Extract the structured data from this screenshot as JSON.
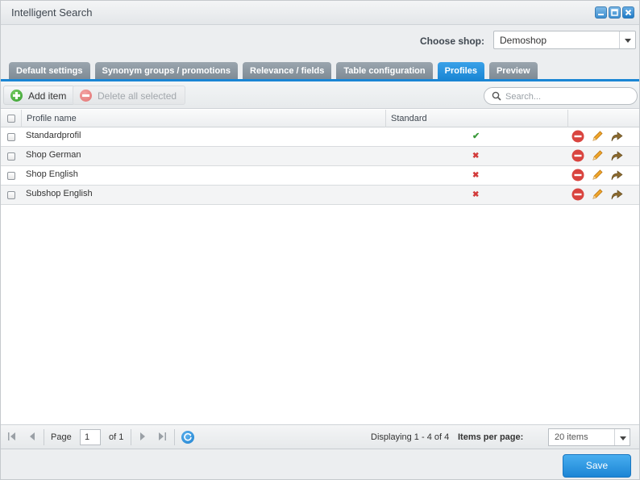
{
  "window": {
    "title": "Intelligent Search"
  },
  "shop": {
    "label": "Choose shop:",
    "selected": "Demoshop"
  },
  "tabs": [
    {
      "label": "Default settings",
      "active": false
    },
    {
      "label": "Synonym groups / promotions",
      "active": false
    },
    {
      "label": "Relevance / fields",
      "active": false
    },
    {
      "label": "Table configuration",
      "active": false
    },
    {
      "label": "Profiles",
      "active": true
    },
    {
      "label": "Preview",
      "active": false
    }
  ],
  "toolbar": {
    "add_label": "Add item",
    "delete_label": "Delete all selected",
    "search_placeholder": "Search..."
  },
  "grid": {
    "columns": [
      "Profile name",
      "Standard"
    ],
    "rows": [
      {
        "name": "Standardprofil",
        "standard": true,
        "standard_glyph": "✔"
      },
      {
        "name": "Shop German",
        "standard": false,
        "standard_glyph": "✖"
      },
      {
        "name": "Shop English",
        "standard": false,
        "standard_glyph": "✖"
      },
      {
        "name": "Subshop English",
        "standard": false,
        "standard_glyph": "✖"
      }
    ]
  },
  "paging": {
    "page_label": "Page",
    "page_value": "1",
    "of_label": "of 1",
    "displaying": "Displaying 1 - 4 of 4",
    "items_per_page_label": "Items per page:",
    "items_per_page_value": "20 items"
  },
  "footer": {
    "save_label": "Save"
  },
  "colors": {
    "accent": "#1a86d4",
    "tab_inactive": "#8a959e",
    "check": "#3a9a3a",
    "cross": "#d23a3a"
  }
}
